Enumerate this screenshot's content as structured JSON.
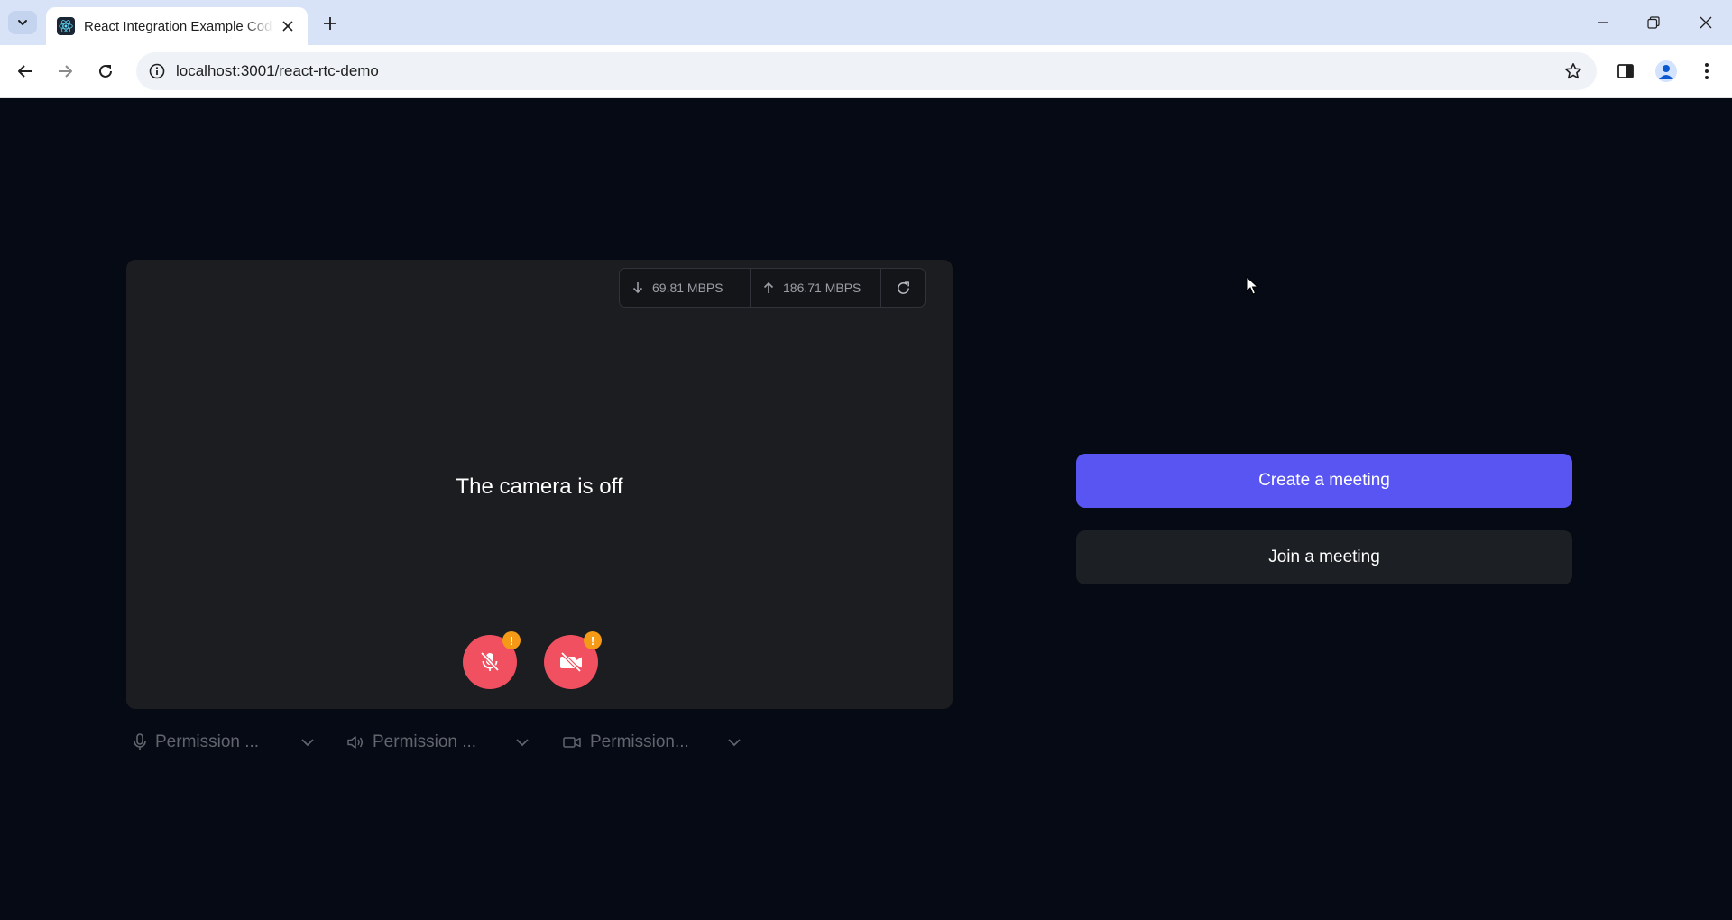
{
  "browser": {
    "tab_title": "React Integration Example Code",
    "url": "localhost:3001/react-rtc-demo",
    "icons": [
      "tab-search-icon",
      "react-logo-icon",
      "close-icon",
      "plus-icon",
      "minimize-icon",
      "restore-icon",
      "close-window-icon",
      "back-arrow-icon",
      "forward-arrow-icon",
      "reload-icon",
      "site-info-icon",
      "bookmark-star-icon",
      "side-panel-icon",
      "profile-icon",
      "more-menu-icon"
    ]
  },
  "preview": {
    "download_speed": "69.81 MBPS",
    "upload_speed": "186.71 MBPS",
    "camera_status": "The camera is off",
    "mic_badge": "!",
    "camera_badge": "!",
    "accent_colors": {
      "mute_button": "#f05060",
      "warning_badge": "#f59a17"
    }
  },
  "devices": {
    "microphone_label": "Permission ...",
    "speaker_label": "Permission ...",
    "camera_label": "Permission..."
  },
  "actions": {
    "create_label": "Create a meeting",
    "join_label": "Join a meeting",
    "create_color": "#5855f2"
  }
}
